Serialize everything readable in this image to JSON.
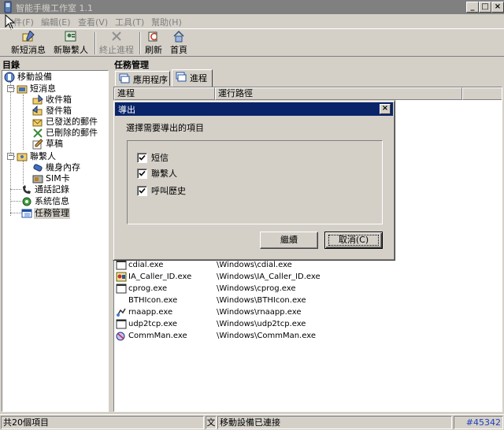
{
  "window": {
    "title": "智能手機工作室 1.1",
    "controls": [
      "_",
      "□",
      "×"
    ]
  },
  "menu": [
    "文件(F)",
    "編輯(E)",
    "查看(V)",
    "工具(T)",
    "幫助(H)"
  ],
  "toolbar": {
    "new_sms": "新短消息",
    "new_contact": "新聯繫人",
    "end_process": "終止進程",
    "refresh": "刷新",
    "home": "首頁"
  },
  "left_pane": {
    "title": "目錄"
  },
  "tree": {
    "mobile": "移動設備",
    "sms": "短消息",
    "inbox": "收件箱",
    "outbox": "發件箱",
    "sent": "已發送的郵件",
    "deleted": "已刪除的郵件",
    "drafts": "草稿",
    "contacts": "聯繫人",
    "phone_memory": "機身內存",
    "sim": "SIM卡",
    "call_log": "通話記錄",
    "system_info": "系統信息",
    "task_manager": "任務管理"
  },
  "right_pane": {
    "title": "任務管理",
    "tabs": [
      "應用程序",
      "進程"
    ],
    "columns": [
      "進程",
      "運行路徑"
    ]
  },
  "processes": [
    {
      "name": "cdial.exe",
      "path": "\\Windows\\cdial.exe",
      "icon": "window-icon"
    },
    {
      "name": "IA_Caller_ID.exe",
      "path": "\\Windows\\IA_Caller_ID.exe",
      "icon": "caller-id-icon"
    },
    {
      "name": "cprog.exe",
      "path": "\\Windows\\cprog.exe",
      "icon": "window-icon"
    },
    {
      "name": "BTHIcon.exe",
      "path": "\\Windows\\BTHIcon.exe",
      "icon": ""
    },
    {
      "name": "rnaapp.exe",
      "path": "\\Windows\\rnaapp.exe",
      "icon": "network-icon"
    },
    {
      "name": "udp2tcp.exe",
      "path": "\\Windows\\udp2tcp.exe",
      "icon": "window-icon"
    },
    {
      "name": "CommMan.exe",
      "path": "\\Windows\\CommMan.exe",
      "icon": "comm-manager-icon"
    }
  ],
  "dialog": {
    "title": "導出",
    "prompt": "選擇需要導出的項目",
    "options": [
      {
        "label": "短信",
        "checked": true
      },
      {
        "label": "聯繫人",
        "checked": true
      },
      {
        "label": "呼叫歷史",
        "checked": true
      }
    ],
    "continue_label": "繼續",
    "cancel_label": "取消(C)"
  },
  "status": {
    "count": "共20個項目",
    "lang": "文",
    "connection": "移動設備已連接",
    "tag": "#45342"
  },
  "colors": {
    "dialog_title_bg": "#0a246a",
    "window_bg": "#d4d0c8",
    "status_tag": "#1f3fbf"
  }
}
